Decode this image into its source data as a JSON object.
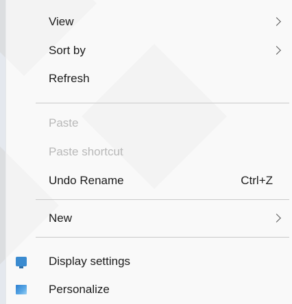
{
  "menu": {
    "view": {
      "label": "View",
      "icon": "chevron-right-icon"
    },
    "sort_by": {
      "label": "Sort by",
      "icon": "chevron-right-icon"
    },
    "refresh": {
      "label": "Refresh"
    },
    "paste": {
      "label": "Paste",
      "disabled": true
    },
    "paste_shortcut": {
      "label": "Paste shortcut",
      "disabled": true
    },
    "undo_rename": {
      "label": "Undo Rename",
      "shortcut": "Ctrl+Z"
    },
    "new": {
      "label": "New",
      "icon": "chevron-right-icon"
    },
    "display_settings": {
      "label": "Display settings",
      "icon": "display-settings-icon"
    },
    "personalize": {
      "label": "Personalize",
      "icon": "personalize-icon"
    }
  },
  "colors": {
    "text": "#1c1c1c",
    "disabled_text": "#b8b8b8",
    "separator": "#c9c9c9",
    "menu_background": "#f7f7f7",
    "display_icon": "#3b8bd0",
    "personalize_icon": "#2e7fd0"
  }
}
